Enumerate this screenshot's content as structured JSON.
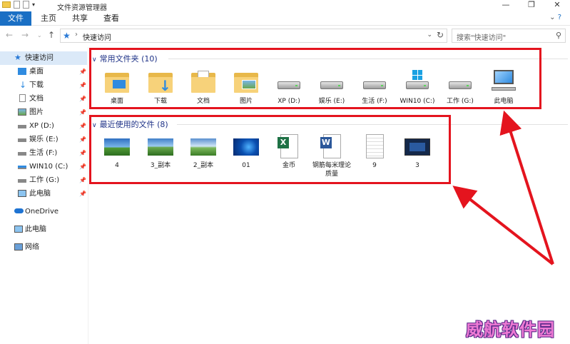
{
  "window": {
    "title": "文件资源管理器"
  },
  "ribbon": {
    "tabs": [
      "文件",
      "主页",
      "共享",
      "查看"
    ]
  },
  "address": {
    "path": "快速访问",
    "search_placeholder": "搜索\"快速访问\""
  },
  "sidebar": {
    "items": [
      {
        "label": "快速访问",
        "icon": "star-icon"
      },
      {
        "label": "桌面",
        "icon": "desktop-icon"
      },
      {
        "label": "下载",
        "icon": "download-icon"
      },
      {
        "label": "文档",
        "icon": "document-icon"
      },
      {
        "label": "图片",
        "icon": "picture-icon"
      },
      {
        "label": "XP (D:)",
        "icon": "drive-icon"
      },
      {
        "label": "娱乐 (E:)",
        "icon": "drive-icon"
      },
      {
        "label": "生活 (F:)",
        "icon": "drive-icon"
      },
      {
        "label": "WIN10 (C:)",
        "icon": "windows-drive-icon"
      },
      {
        "label": "工作 (G:)",
        "icon": "drive-icon"
      },
      {
        "label": "此电脑",
        "icon": "computer-icon"
      },
      {
        "label": "OneDrive",
        "icon": "cloud-icon"
      },
      {
        "label": "此电脑",
        "icon": "computer-icon"
      },
      {
        "label": "网络",
        "icon": "network-icon"
      }
    ]
  },
  "frequent": {
    "header": "常用文件夹 (10)",
    "items": [
      {
        "label": "桌面",
        "icon": "desktop-folder-icon"
      },
      {
        "label": "下载",
        "icon": "download-folder-icon"
      },
      {
        "label": "文档",
        "icon": "documents-folder-icon"
      },
      {
        "label": "图片",
        "icon": "pictures-folder-icon"
      },
      {
        "label": "XP (D:)",
        "icon": "drive-icon"
      },
      {
        "label": "娱乐 (E:)",
        "icon": "drive-icon"
      },
      {
        "label": "生活 (F:)",
        "icon": "drive-icon"
      },
      {
        "label": "WIN10 (C:)",
        "icon": "windows-drive-icon"
      },
      {
        "label": "工作 (G:)",
        "icon": "drive-icon"
      },
      {
        "label": "此电脑",
        "icon": "computer-icon"
      }
    ]
  },
  "recent": {
    "header": "最近使用的文件 (8)",
    "items": [
      {
        "label": "4",
        "icon": "landscape-thumbnail"
      },
      {
        "label": "3_副本",
        "icon": "landscape-thumbnail"
      },
      {
        "label": "2_副本",
        "icon": "landscape-thumbnail"
      },
      {
        "label": "01",
        "icon": "windows-desktop-thumbnail"
      },
      {
        "label": "金币",
        "icon": "excel-file-icon"
      },
      {
        "label": "钢筋每米理论质量",
        "icon": "word-file-icon"
      },
      {
        "label": "9",
        "icon": "document-thumbnail"
      },
      {
        "label": "3",
        "icon": "screen-thumbnail"
      }
    ]
  },
  "watermark": "威航软件园",
  "colors": {
    "accent": "#1a6fc4",
    "annotation": "#e4141e",
    "group_header": "#1e3287"
  }
}
